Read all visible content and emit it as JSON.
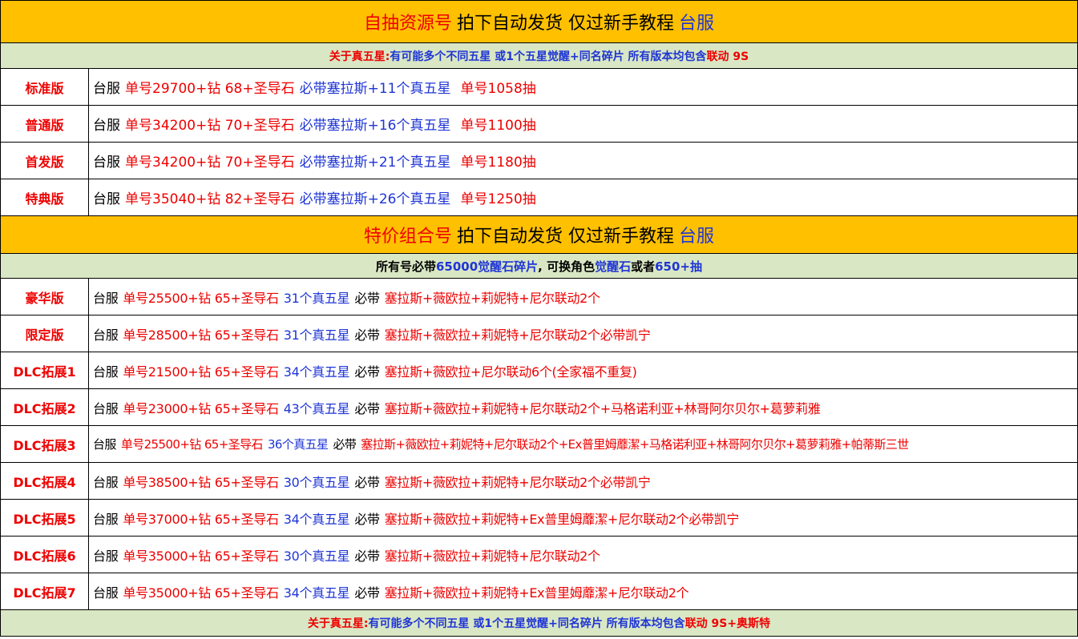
{
  "colors": {
    "banner_bg": "#ffc000",
    "note_bg": "#d9e7c4",
    "red": "#ee0000",
    "blue": "#1f35d6",
    "black": "#000000"
  },
  "section1": {
    "banner": {
      "red": "自抽资源号",
      "black": "拍下自动发货 仅过新手教程",
      "blue": "台服"
    },
    "note": {
      "red": "关于真五星:",
      "blue": "有可能多个不同五星 或1个五星觉醒+同名碎片 所有版本均包含",
      "red2": "联动 9S"
    },
    "rows": [
      {
        "label": "标准版",
        "server": "台服",
        "account": "单号29700+钻 68+圣导石",
        "content": "必带塞拉斯+11个真五星",
        "pulls": "单号1058抽"
      },
      {
        "label": "普通版",
        "server": "台服",
        "account": "单号34200+钻 70+圣导石",
        "content": "必带塞拉斯+16个真五星",
        "pulls": "单号1100抽"
      },
      {
        "label": "首发版",
        "server": "台服",
        "account": "单号34200+钻 70+圣导石",
        "content": "必带塞拉斯+21个真五星",
        "pulls": "单号1180抽"
      },
      {
        "label": "特典版",
        "server": "台服",
        "account": "单号35040+钻 82+圣导石",
        "content": "必带塞拉斯+26个真五星",
        "pulls": "单号1250抽"
      }
    ]
  },
  "section2": {
    "banner": {
      "red": "特价组合号",
      "black": "拍下自动发货 仅过新手教程",
      "blue": "台服"
    },
    "note": {
      "p1": "所有号必带",
      "p2": "65000觉醒石碎片",
      "p3": ", 可换角色",
      "p4": "觉醒石",
      "p5": "或者",
      "p6": "650+抽"
    },
    "rows": [
      {
        "label": "豪华版",
        "server": "台服",
        "account": "单号25500+钻 65+圣导石",
        "stars": "31个真五星",
        "must": "必带",
        "chars": "塞拉斯+薇欧拉+莉妮特+尼尔联动2个"
      },
      {
        "label": "限定版",
        "server": "台服",
        "account": "单号28500+钻 65+圣导石",
        "stars": "31个真五星",
        "must": "必带",
        "chars": "塞拉斯+薇欧拉+莉妮特+尼尔联动2个必带凯宁"
      },
      {
        "label": "DLC拓展1",
        "server": "台服",
        "account": "单号21500+钻 65+圣导石",
        "stars": "34个真五星",
        "must": "必带",
        "chars": "塞拉斯+薇欧拉+尼尔联动6个(全家福不重复)"
      },
      {
        "label": "DLC拓展2",
        "server": "台服",
        "account": "单号23000+钻 65+圣导石",
        "stars": "43个真五星",
        "must": "必带",
        "chars": "塞拉斯+薇欧拉+莉妮特+尼尔联动2个+马格诺利亚+林哥阿尔贝尔+葛萝莉雅"
      },
      {
        "label": "DLC拓展3",
        "server": "台服",
        "account": "单号25500+钻 65+圣导石",
        "stars": "36个真五星",
        "must": "必带",
        "chars": "塞拉斯+薇欧拉+莉妮特+尼尔联动2个+Ex普里姆蘼潔+马格诺利亚+林哥阿尔贝尔+葛萝莉雅+帕蒂斯三世"
      },
      {
        "label": "DLC拓展4",
        "server": "台服",
        "account": "单号38500+钻 65+圣导石",
        "stars": "30个真五星",
        "must": "必带",
        "chars": "塞拉斯+薇欧拉+莉妮特+尼尔联动2个必带凯宁"
      },
      {
        "label": "DLC拓展5",
        "server": "台服",
        "account": "单号37000+钻 65+圣导石",
        "stars": "34个真五星",
        "must": "必带",
        "chars": "塞拉斯+薇欧拉+莉妮特+Ex普里姆蘼潔+尼尔联动2个必带凯宁"
      },
      {
        "label": "DLC拓展6",
        "server": "台服",
        "account": "单号35000+钻 65+圣导石",
        "stars": "30个真五星",
        "must": "必带",
        "chars": "塞拉斯+薇欧拉+莉妮特+尼尔联动2个"
      },
      {
        "label": "DLC拓展7",
        "server": "台服",
        "account": "单号35000+钻 65+圣导石",
        "stars": "34个真五星",
        "must": "必带",
        "chars": "塞拉斯+薇欧拉+莉妮特+Ex普里姆蘼潔+尼尔联动2个"
      }
    ]
  },
  "footer": {
    "red": "关于真五星:",
    "blue": "有可能多个不同五星 或1个五星觉醒+同名碎片 所有版本均包含",
    "red2": "联动 9S+奥斯特"
  }
}
